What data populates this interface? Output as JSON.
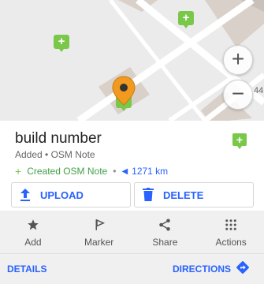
{
  "map": {
    "scale_fragment": "44",
    "zoom_in_label": "+",
    "zoom_out_label": "−"
  },
  "place": {
    "title": "build number",
    "subtitle": "Added • OSM Note",
    "created_label": "Created OSM Note",
    "separator": "•",
    "distance": "1271 km"
  },
  "actions": {
    "upload_label": "UPLOAD",
    "delete_label": "DELETE"
  },
  "toolbar": {
    "items": [
      {
        "label": "Add",
        "icon": "star-icon"
      },
      {
        "label": "Marker",
        "icon": "flag-icon"
      },
      {
        "label": "Share",
        "icon": "share-icon"
      },
      {
        "label": "Actions",
        "icon": "grid-dots-icon"
      }
    ]
  },
  "footer": {
    "details_label": "DETAILS",
    "directions_label": "DIRECTIONS"
  },
  "colors": {
    "accent": "#2962ff",
    "note_green": "#79c84a",
    "marker_orange": "#f29a1f"
  }
}
